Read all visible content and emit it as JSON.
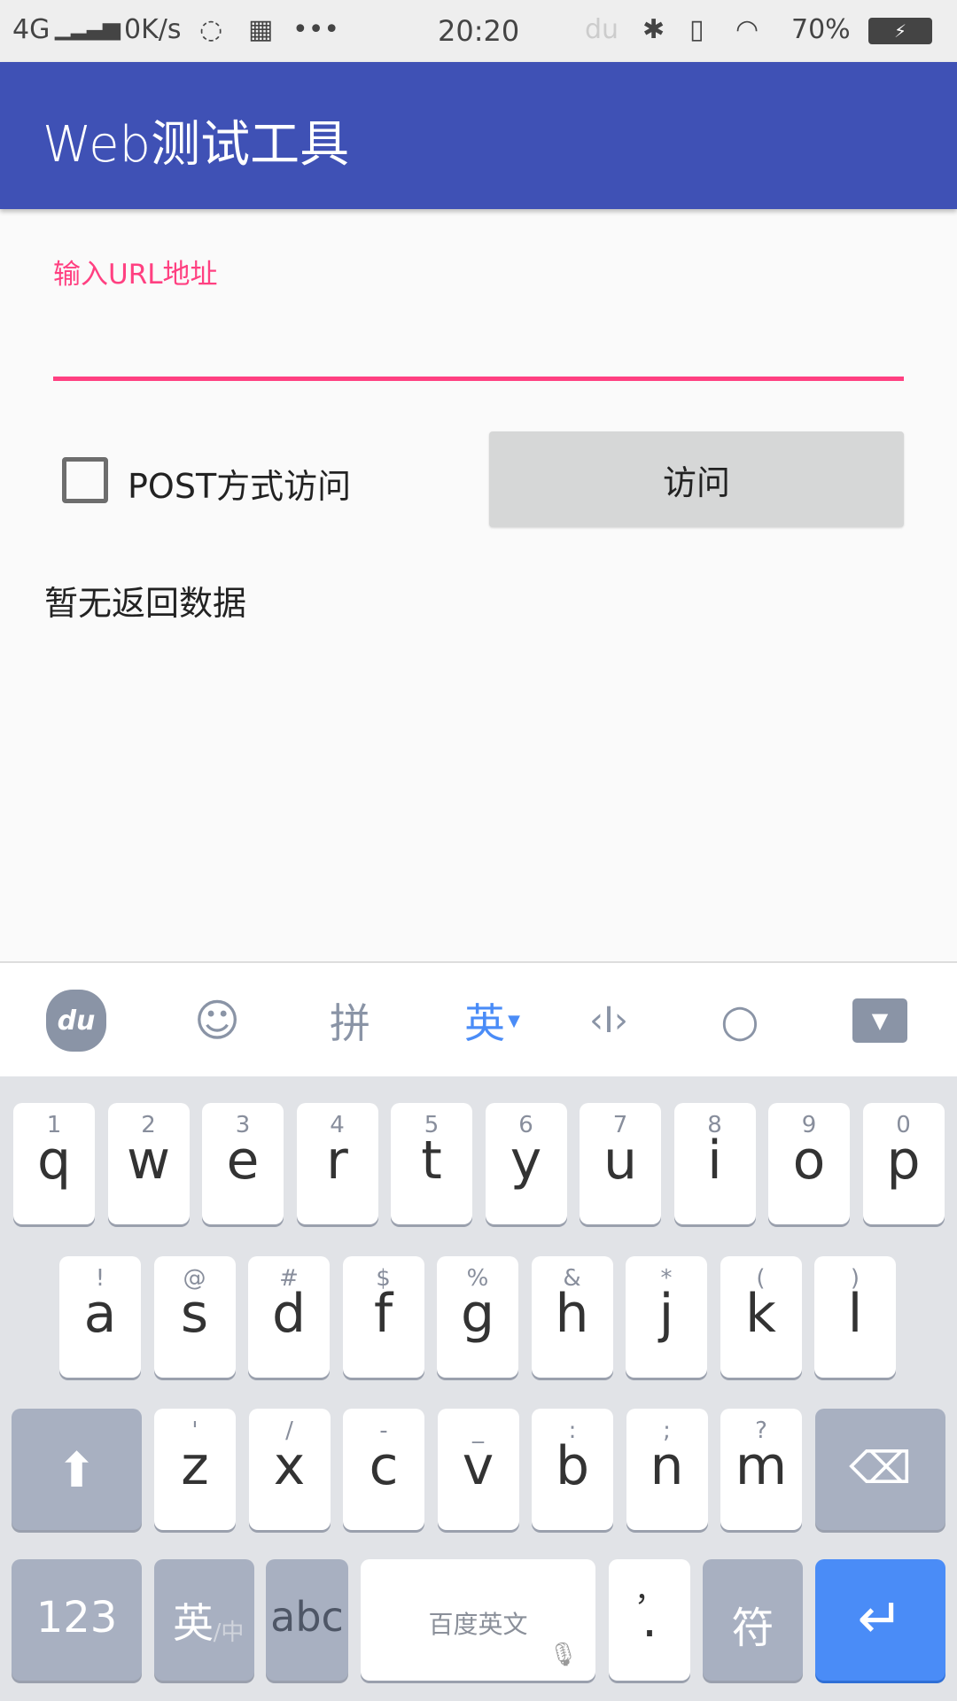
{
  "status_bar": {
    "network": "4G",
    "speed": "0K/s",
    "time": "20:20",
    "battery": "70%"
  },
  "app": {
    "title": "Web测试工具"
  },
  "form": {
    "url_label": "输入URL地址",
    "url_value": "",
    "post_label": "POST方式访问",
    "post_checked": false,
    "visit_button": "访问",
    "result_text": "暂无返回数据"
  },
  "keyboard": {
    "toolbar": {
      "pinyin": "拼",
      "english": "英"
    },
    "rows": [
      [
        [
          "q",
          "1"
        ],
        [
          "w",
          "2"
        ],
        [
          "e",
          "3"
        ],
        [
          "r",
          "4"
        ],
        [
          "t",
          "5"
        ],
        [
          "y",
          "6"
        ],
        [
          "u",
          "7"
        ],
        [
          "i",
          "8"
        ],
        [
          "o",
          "9"
        ],
        [
          "p",
          "0"
        ]
      ],
      [
        [
          "a",
          "!"
        ],
        [
          "s",
          "@"
        ],
        [
          "d",
          "#"
        ],
        [
          "f",
          "$"
        ],
        [
          "g",
          "%"
        ],
        [
          "h",
          "&"
        ],
        [
          "j",
          "*"
        ],
        [
          "k",
          "("
        ],
        [
          "l",
          ")"
        ]
      ],
      [
        [
          "z",
          "'"
        ],
        [
          "x",
          "/"
        ],
        [
          "c",
          "-"
        ],
        [
          "v",
          "_"
        ],
        [
          "b",
          ":"
        ],
        [
          "n",
          ";"
        ],
        [
          "m",
          "?"
        ]
      ]
    ],
    "num_label": "123",
    "lang_label": "英",
    "lang_sub": "/中",
    "abc_label": "abc",
    "space_label": "百度英文",
    "comma": "，",
    "period": ".",
    "symbol_label": "符",
    "accent_color": "#4a8cf7"
  }
}
